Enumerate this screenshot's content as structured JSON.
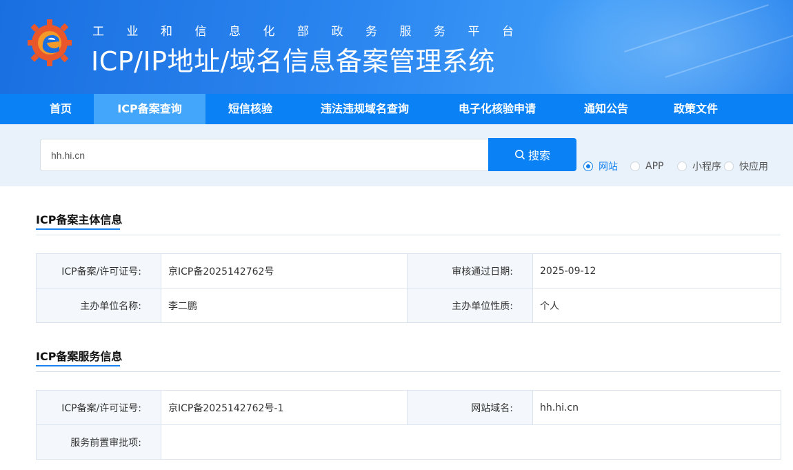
{
  "header": {
    "subtitle": "工业和信息化部政务服务平台",
    "title": "ICP/IP地址/域名信息备案管理系统"
  },
  "nav": {
    "items": [
      {
        "label": "首页"
      },
      {
        "label": "ICP备案查询",
        "active": true
      },
      {
        "label": "短信核验"
      },
      {
        "label": "违法违规域名查询"
      },
      {
        "label": "电子化核验申请"
      },
      {
        "label": "通知公告"
      },
      {
        "label": "政策文件"
      }
    ]
  },
  "search": {
    "value": "hh.hi.cn",
    "button_label": "搜索",
    "button_icon": "search-icon",
    "options": [
      {
        "label": "网站",
        "checked": true
      },
      {
        "label": "APP",
        "checked": false
      },
      {
        "label": "小程序",
        "checked": false
      },
      {
        "label": "快应用",
        "checked": false
      }
    ]
  },
  "subject_info": {
    "title": "ICP备案主体信息",
    "rows": [
      [
        {
          "label": "ICP备案/许可证号:",
          "value": "京ICP备2025142762号"
        },
        {
          "label": "审核通过日期:",
          "value": "2025-09-12"
        }
      ],
      [
        {
          "label": "主办单位名称:",
          "value": "李二鹏"
        },
        {
          "label": "主办单位性质:",
          "value": "个人"
        }
      ]
    ]
  },
  "service_info": {
    "title": "ICP备案服务信息",
    "license_label": "ICP备案/许可证号:",
    "license_value": "京ICP备2025142762号-1",
    "domain_label": "网站域名:",
    "domain_value": "hh.hi.cn",
    "approval_label": "服务前置审批项:",
    "approval_value": ""
  },
  "colors": {
    "primary": "#0a82f5",
    "nav_active": "#44a6fb",
    "accent_text": "#1582f0",
    "search_bg": "#e9f2fb",
    "key_cell_bg": "#f4f8fc"
  }
}
